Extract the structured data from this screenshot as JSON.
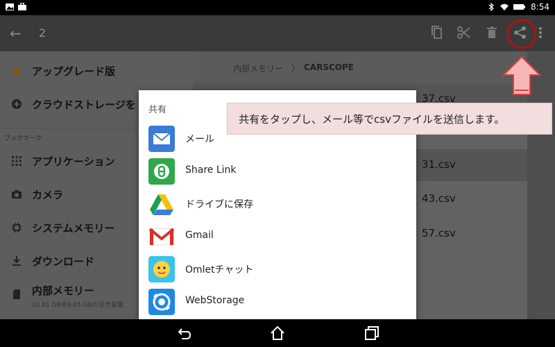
{
  "status_bar": {
    "time": "8:54",
    "icons_left": [
      "photo-icon",
      "briefcase-icon"
    ],
    "icons_right": [
      "bluetooth-icon",
      "wifi-icon",
      "battery-icon"
    ]
  },
  "toolbar": {
    "selected_count": "2",
    "actions": [
      "copy-icon",
      "cut-icon",
      "delete-icon",
      "share-icon",
      "more-icon"
    ]
  },
  "sidebar": {
    "items": [
      {
        "label": "アップグレード版",
        "icon": "star-icon"
      },
      {
        "label": "クラウドストレージを",
        "icon": "add-circle-icon"
      }
    ],
    "bookmarks_header": "ブックマーク",
    "bookmarks": [
      {
        "label": "アプリケーション",
        "icon": "grid-icon"
      },
      {
        "label": "カメラ",
        "icon": "camera-icon"
      },
      {
        "label": "システムメモリー",
        "icon": "chip-icon"
      },
      {
        "label": "ダウンロード",
        "icon": "download-icon"
      },
      {
        "label": "内部メモリー",
        "icon": "sd-card-icon",
        "sublabel": "10.81 GB中6.65 GBの空き容量"
      }
    ]
  },
  "breadcrumb": {
    "root": "内部メモリー",
    "separator": "〉",
    "current": "CARSCOPE"
  },
  "files": [
    {
      "name_suffix": "37.csv",
      "selected": true
    },
    {
      "name_suffix": "31.csv",
      "selected": true
    },
    {
      "name_suffix": "43.csv",
      "selected": false
    },
    {
      "name_suffix": "57.csv",
      "selected": false
    }
  ],
  "share_dialog": {
    "title": "共有",
    "apps": [
      {
        "label": "メール",
        "icon": "mail-icon",
        "color": "#3a7bd5"
      },
      {
        "label": "Share Link",
        "icon": "share-link-icon",
        "color": "#2ea84a"
      },
      {
        "label": "ドライブに保存",
        "icon": "google-drive-icon",
        "color": "#f4c20d"
      },
      {
        "label": "Gmail",
        "icon": "gmail-icon",
        "color": "#d93025"
      },
      {
        "label": "Omletチャット",
        "icon": "omlet-icon",
        "color": "#3cc3e8"
      },
      {
        "label": "WebStorage",
        "icon": "webstorage-icon",
        "color": "#1e88e5"
      }
    ]
  },
  "callout": {
    "text": "共有をタップし、メール等でcsvファイルを送信します。"
  },
  "colors": {
    "highlight": "#e00000",
    "arrow_fill": "#f7b7b7",
    "arrow_stroke": "#e04040",
    "callout_bg": "#f2dede"
  }
}
